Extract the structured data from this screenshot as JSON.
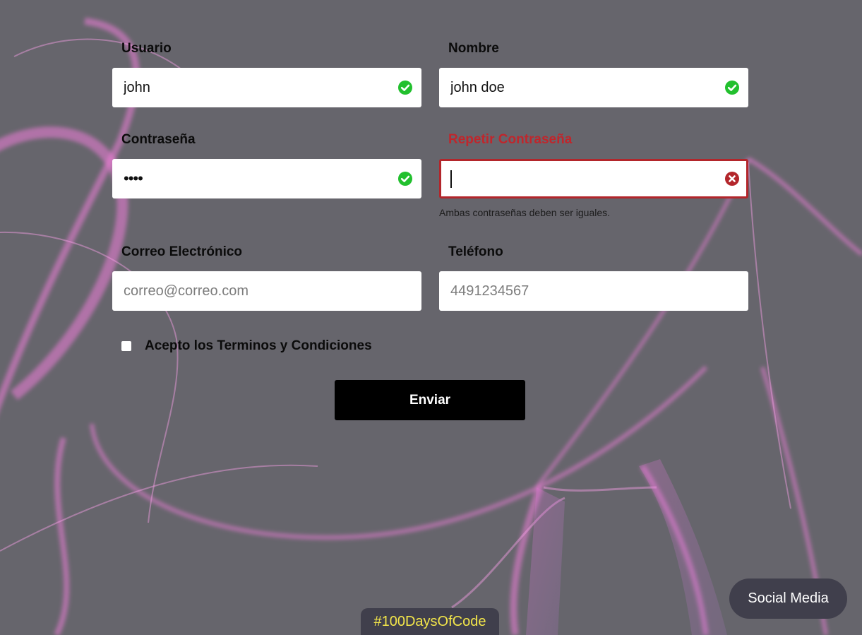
{
  "colors": {
    "background": "#66656c",
    "neon": "#f07bd8",
    "success": "#22c02e",
    "error": "#c0262c",
    "button": "#000000",
    "pill": "#403f4c",
    "hashtag_text": "#f3e64a"
  },
  "form": {
    "usuario": {
      "label": "Usuario",
      "value": "john",
      "status": "valid",
      "icon": "check-circle-icon"
    },
    "nombre": {
      "label": "Nombre",
      "value": "john doe",
      "status": "valid",
      "icon": "check-circle-icon"
    },
    "password": {
      "label": "Contraseña",
      "value": "••••",
      "status": "valid",
      "icon": "check-circle-icon"
    },
    "repeat_password": {
      "label": "Repetir Contraseña",
      "value": "",
      "status": "error",
      "icon": "x-circle-icon",
      "error_message": "Ambas contraseñas deben ser iguales."
    },
    "email": {
      "label": "Correo Electrónico",
      "placeholder": "correo@correo.com"
    },
    "phone": {
      "label": "Teléfono",
      "placeholder": "4491234567"
    },
    "terms": {
      "label": "Acepto los Terminos y Condiciones",
      "checked": false
    },
    "submit_label": "Enviar"
  },
  "social_button_label": "Social Media",
  "hashtag_label": "#100DaysOfCode"
}
